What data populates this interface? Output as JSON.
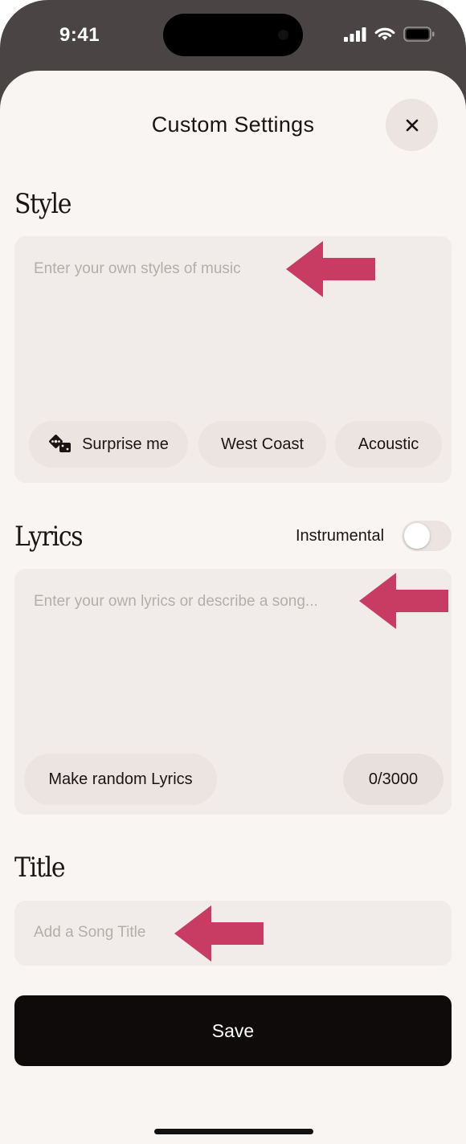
{
  "status_bar": {
    "time": "9:41",
    "icons": [
      "cellular-signal-icon",
      "wifi-icon",
      "battery-icon"
    ]
  },
  "header": {
    "title": "Custom Settings",
    "close_icon": "close-icon"
  },
  "style_section": {
    "label": "Style",
    "placeholder": "Enter your own styles of music",
    "chips": [
      {
        "label": "Surprise me",
        "icon": "dice-icon"
      },
      {
        "label": "West Coast"
      },
      {
        "label": "Acoustic"
      }
    ]
  },
  "lyrics_section": {
    "label": "Lyrics",
    "instrumental_label": "Instrumental",
    "instrumental_on": false,
    "placeholder": "Enter your own lyrics or describe a song...",
    "random_button": "Make random Lyrics",
    "counter": "0/3000"
  },
  "title_section": {
    "label": "Title",
    "placeholder": "Add a Song Title"
  },
  "save_button": "Save",
  "colors": {
    "annotation_arrow": "#c83c64",
    "save_background": "#100b0b",
    "sheet_background": "#f9f5f3",
    "field_background": "#f1ecea"
  }
}
